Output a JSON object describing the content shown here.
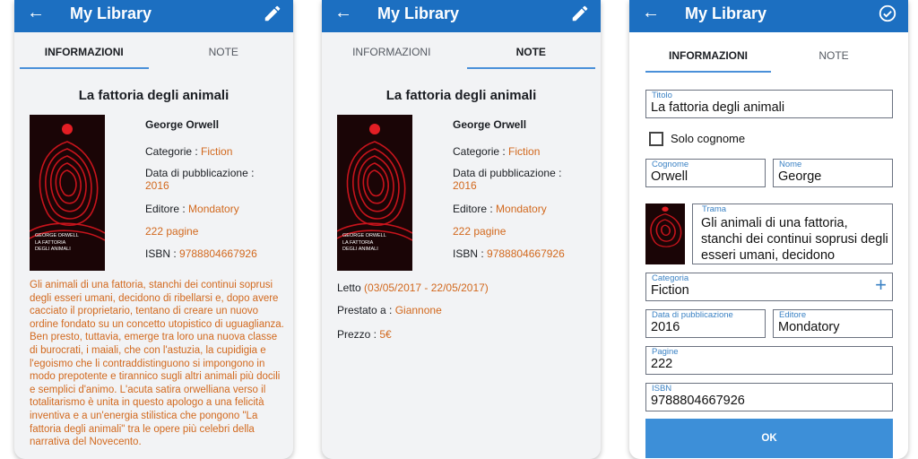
{
  "app": {
    "title": "My Library"
  },
  "tabs": {
    "info": "INFORMAZIONI",
    "notes": "NOTE"
  },
  "book": {
    "title": "La fattoria degli animali",
    "author": "George Orwell",
    "author_first": "George",
    "author_last": "Orwell",
    "category_label": "Categorie : ",
    "category": "Fiction",
    "pub_label": "Data di pubblicazione :",
    "pub_year": "2016",
    "publisher_label": "Editore : ",
    "publisher": "Mondatory",
    "pages_text": "222 pagine",
    "pages": "222",
    "isbn_label": "ISBN : ",
    "isbn": "9788804667926",
    "cover_author": "GEORGE ORWELL",
    "cover_title_1": "LA FATTORIA",
    "cover_title_2": "DEGLI ANIMALI",
    "plot": "Gli animali di una fattoria, stanchi dei continui soprusi degli esseri umani, decidono di ribellarsi e, dopo avere cacciato il proprietario, tentano di creare un nuovo ordine fondato su un concetto utopistico di uguaglianza. Ben presto, tuttavia, emerge tra loro una nuova classe di burocrati, i maiali, che con l'astuzia, la cupidigia e l'egoismo che li contraddistinguono si impongono in modo prepotente e tirannico sugli altri animali più docili e semplici d'animo. L'acuta satira orwelliana verso il totalitarismo è unita in questo apologo a una felicità inventiva e a un'energia stilistica che pongono \"La fattoria degli animali\" tra le opere più celebri della narrativa del Novecento.",
    "plot_short": "Gli animali di una fattoria, stanchi dei continui soprusi degli esseri umani, decidono"
  },
  "notes": {
    "read_label": "Letto ",
    "read_value": "(03/05/2017 - 22/05/2017)",
    "lent_label": "Prestato a : ",
    "lent_value": "Giannone",
    "price_label": "Prezzo : ",
    "price_value": "5€"
  },
  "form": {
    "title_label": "Titolo",
    "surname_only": "Solo cognome",
    "surname_label": "Cognome",
    "name_label": "Nome",
    "plot_label": "Trama",
    "category_label": "Categoria",
    "pub_label": "Data di pubblicazione",
    "publisher_label": "Editore",
    "pages_label": "Pagine",
    "isbn_label": "ISBN",
    "ok": "OK"
  },
  "colors": {
    "appbar": "#1c6fc1",
    "accent": "#d2691e",
    "tab_indicator": "#4a90d9",
    "button": "#3d8fd8"
  }
}
